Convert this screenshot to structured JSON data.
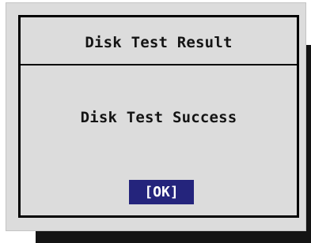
{
  "dialog": {
    "title": "Disk Test Result",
    "message": "Disk Test Success",
    "ok_label": "[OK]"
  },
  "colors": {
    "panel_background": "#dcdcdc",
    "border": "#000000",
    "shadow": "#141414",
    "button_background": "#24247c",
    "button_text": "#ffffff",
    "text": "#141414"
  }
}
